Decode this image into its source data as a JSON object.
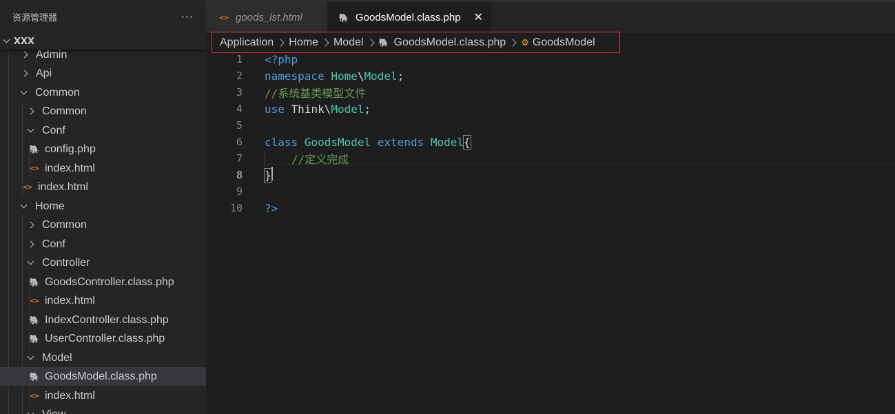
{
  "explorer": {
    "title": "资源管理器",
    "more_label": "···",
    "root": "XXX",
    "items": [
      {
        "label": "Admin",
        "type": "folder",
        "expanded": false
      },
      {
        "label": "Api",
        "type": "folder",
        "expanded": false
      },
      {
        "label": "Common",
        "type": "folder",
        "expanded": true
      },
      {
        "label": "Common",
        "type": "folder",
        "expanded": false
      },
      {
        "label": "Conf",
        "type": "folder",
        "expanded": true
      },
      {
        "label": "config.php",
        "type": "php"
      },
      {
        "label": "index.html",
        "type": "html"
      },
      {
        "label": "index.html",
        "type": "html"
      },
      {
        "label": "Home",
        "type": "folder",
        "expanded": true
      },
      {
        "label": "Common",
        "type": "folder",
        "expanded": false
      },
      {
        "label": "Conf",
        "type": "folder",
        "expanded": false
      },
      {
        "label": "Controller",
        "type": "folder",
        "expanded": true
      },
      {
        "label": "GoodsController.class.php",
        "type": "php"
      },
      {
        "label": "index.html",
        "type": "html"
      },
      {
        "label": "IndexController.class.php",
        "type": "php"
      },
      {
        "label": "UserController.class.php",
        "type": "php"
      },
      {
        "label": "Model",
        "type": "folder",
        "expanded": true
      },
      {
        "label": "GoodsModel.class.php",
        "type": "php",
        "selected": true
      },
      {
        "label": "index.html",
        "type": "html"
      },
      {
        "label": "View",
        "type": "folder",
        "expanded": true
      }
    ]
  },
  "tabs": [
    {
      "label": "goods_lst.html",
      "icon": "html-icon",
      "active": false
    },
    {
      "label": "GoodsModel.class.php",
      "icon": "php-icon",
      "active": true,
      "close": "✕"
    }
  ],
  "breadcrumb": {
    "items": [
      "Application",
      "Home",
      "Model",
      "GoodsModel.class.php",
      "GoodsModel"
    ]
  },
  "editor": {
    "line_numbers": [
      "1",
      "2",
      "3",
      "4",
      "5",
      "6",
      "7",
      "8",
      "9",
      "10"
    ],
    "current_line": "8",
    "lines": {
      "l1": {
        "open": "<?php"
      },
      "l2": {
        "kw": "namespace",
        "ns1": "Home",
        "sep": "\\",
        "ns2": "Model",
        "end": ";"
      },
      "l3": {
        "comment": "//系统基类模型文件"
      },
      "l4": {
        "kw": "use",
        "ns1": "Think",
        "sep": "\\",
        "ns2": "Model",
        "end": ";"
      },
      "l6": {
        "kw1": "class",
        "name": "GoodsModel",
        "kw2": "extends",
        "parent": "Model",
        "brace": "{"
      },
      "l7": {
        "comment": "//定义完成"
      },
      "l8": {
        "brace": "}"
      },
      "l10": {
        "close": "?>"
      }
    }
  },
  "colors": {
    "keyword": "#569cd6",
    "type": "#4ec9b0",
    "comment": "#6a9955",
    "php_icon": "#a074c4",
    "html_icon": "#e37933",
    "highlight_border": "#e03030"
  }
}
